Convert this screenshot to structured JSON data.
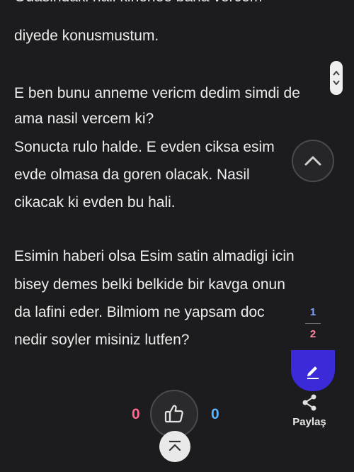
{
  "post": {
    "lines": [
      "Odasindaki hali kirlenee bana vercem",
      "diyede konusmustum.",
      "E ben bunu anneme vericm dedim simdi de",
      "ama nasil vercem ki?",
      "Sonucta rulo halde. E evden ciksa esim",
      "evde olmasa da goren olacak. Nasil",
      "cikacak ki evden bu hali.",
      "Esimin haberi olsa Esim satin almadigi icin",
      "bisey demes belki belkide bir kavga onun",
      "da lafini eder. Bilmiom ne yapsam doc",
      "nedir soyler misiniz lutfen?"
    ]
  },
  "pager": {
    "current": "1",
    "total": "2"
  },
  "actions": {
    "share_label": "Paylaş",
    "dislike_count": "0",
    "like_count": "0"
  },
  "colors": {
    "background": "#1c1c1e",
    "edit_button": "#3a2ad8",
    "dislike_count": "#ff6b8e",
    "like_count": "#5bb6ff"
  }
}
